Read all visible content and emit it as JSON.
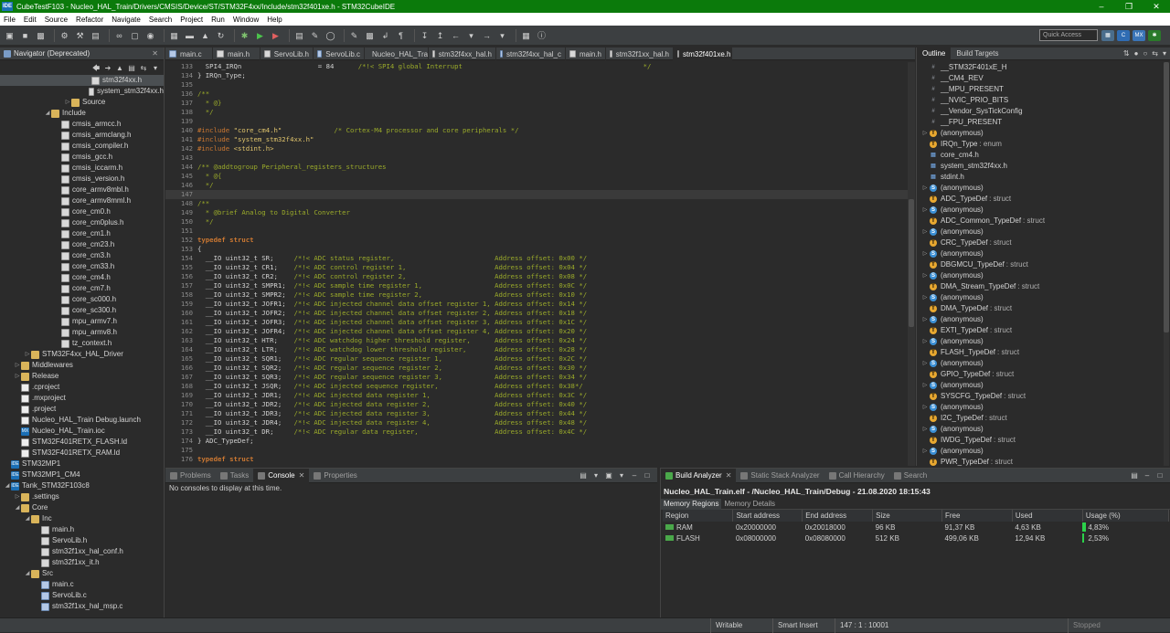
{
  "window": {
    "title": "CubeTestF103 - Nucleo_HAL_Train/Drivers/CMSIS/Device/ST/STM32F4xx/Include/stm32f401xe.h - STM32CubeIDE",
    "app_icon": "IDE"
  },
  "menu": [
    "File",
    "Edit",
    "Source",
    "Refactor",
    "Navigate",
    "Search",
    "Project",
    "Run",
    "Window",
    "Help"
  ],
  "quick_access": {
    "placeholder": "Quick Access"
  },
  "navigator": {
    "title": "Navigator (Deprecated)",
    "items": [
      {
        "label": "stm32f4xx.h",
        "level": 8,
        "icon": "h",
        "selected": true
      },
      {
        "label": "system_stm32f4xx.h",
        "level": 8,
        "icon": "h"
      },
      {
        "label": "Source",
        "level": 6,
        "icon": "folder",
        "twisty": "closed"
      },
      {
        "label": "Include",
        "level": 4,
        "icon": "folder",
        "twisty": "open"
      },
      {
        "label": "cmsis_armcc.h",
        "level": 5,
        "icon": "h"
      },
      {
        "label": "cmsis_armclang.h",
        "level": 5,
        "icon": "h"
      },
      {
        "label": "cmsis_compiler.h",
        "level": 5,
        "icon": "h"
      },
      {
        "label": "cmsis_gcc.h",
        "level": 5,
        "icon": "h"
      },
      {
        "label": "cmsis_iccarm.h",
        "level": 5,
        "icon": "h"
      },
      {
        "label": "cmsis_version.h",
        "level": 5,
        "icon": "h"
      },
      {
        "label": "core_armv8mbl.h",
        "level": 5,
        "icon": "h"
      },
      {
        "label": "core_armv8mml.h",
        "level": 5,
        "icon": "h"
      },
      {
        "label": "core_cm0.h",
        "level": 5,
        "icon": "h"
      },
      {
        "label": "core_cm0plus.h",
        "level": 5,
        "icon": "h"
      },
      {
        "label": "core_cm1.h",
        "level": 5,
        "icon": "h"
      },
      {
        "label": "core_cm23.h",
        "level": 5,
        "icon": "h"
      },
      {
        "label": "core_cm3.h",
        "level": 5,
        "icon": "h"
      },
      {
        "label": "core_cm33.h",
        "level": 5,
        "icon": "h"
      },
      {
        "label": "core_cm4.h",
        "level": 5,
        "icon": "h"
      },
      {
        "label": "core_cm7.h",
        "level": 5,
        "icon": "h"
      },
      {
        "label": "core_sc000.h",
        "level": 5,
        "icon": "h"
      },
      {
        "label": "core_sc300.h",
        "level": 5,
        "icon": "h"
      },
      {
        "label": "mpu_armv7.h",
        "level": 5,
        "icon": "h"
      },
      {
        "label": "mpu_armv8.h",
        "level": 5,
        "icon": "h"
      },
      {
        "label": "tz_context.h",
        "level": 5,
        "icon": "h"
      },
      {
        "label": "STM32F4xx_HAL_Driver",
        "level": 2,
        "icon": "folder",
        "twisty": "closed"
      },
      {
        "label": "Middlewares",
        "level": 1,
        "icon": "folder",
        "twisty": "closed"
      },
      {
        "label": "Release",
        "level": 1,
        "icon": "folder",
        "twisty": "closed"
      },
      {
        "label": ".cproject",
        "level": 1,
        "icon": "file"
      },
      {
        "label": ".mxproject",
        "level": 1,
        "icon": "file"
      },
      {
        "label": ".project",
        "level": 1,
        "icon": "file"
      },
      {
        "label": "Nucleo_HAL_Train Debug.launch",
        "level": 1,
        "icon": "file"
      },
      {
        "label": "Nucleo_HAL_Train.ioc",
        "level": 1,
        "icon": "mx"
      },
      {
        "label": "STM32F401RETX_FLASH.ld",
        "level": 1,
        "icon": "file"
      },
      {
        "label": "STM32F401RETX_RAM.ld",
        "level": 1,
        "icon": "file"
      },
      {
        "label": "STM32MP1",
        "level": 0,
        "icon": "proj"
      },
      {
        "label": "STM32MP1_CM4",
        "level": 0,
        "icon": "proj"
      },
      {
        "label": "Tank_STM32F103c8",
        "level": 0,
        "icon": "proj",
        "twisty": "open"
      },
      {
        "label": ".settings",
        "level": 1,
        "icon": "folder",
        "twisty": "closed"
      },
      {
        "label": "Core",
        "level": 1,
        "icon": "folder",
        "twisty": "open"
      },
      {
        "label": "Inc",
        "level": 2,
        "icon": "folder",
        "twisty": "open"
      },
      {
        "label": "main.h",
        "level": 3,
        "icon": "h"
      },
      {
        "label": "ServoLib.h",
        "level": 3,
        "icon": "h"
      },
      {
        "label": "stm32f1xx_hal_conf.h",
        "level": 3,
        "icon": "h"
      },
      {
        "label": "stm32f1xx_it.h",
        "level": 3,
        "icon": "h"
      },
      {
        "label": "Src",
        "level": 2,
        "icon": "folder",
        "twisty": "open"
      },
      {
        "label": "main.c",
        "level": 3,
        "icon": "c"
      },
      {
        "label": "ServoLib.c",
        "level": 3,
        "icon": "c"
      },
      {
        "label": "stm32f1xx_hal_msp.c",
        "level": 3,
        "icon": "c"
      }
    ]
  },
  "editor": {
    "tabs": [
      {
        "label": "main.c",
        "icon": "c"
      },
      {
        "label": "main.h",
        "icon": "h"
      },
      {
        "label": "ServoLib.h",
        "icon": "h"
      },
      {
        "label": "ServoLib.c",
        "icon": "c"
      },
      {
        "label": "Nucleo_HAL_Trai",
        "icon": "mx"
      },
      {
        "label": "stm32f4xx_hal.h",
        "icon": "h"
      },
      {
        "label": "stm32f4xx_hal_c",
        "icon": "c"
      },
      {
        "label": "main.h",
        "icon": "h"
      },
      {
        "label": "stm32f1xx_hal.h",
        "icon": "h"
      },
      {
        "label": "stm32f401xe.h",
        "icon": "h",
        "active": true
      }
    ],
    "lines": [
      {
        "n": "133",
        "t": "  SPI4_IRQn                   = 84      /*!< SPI4 global Interrupt                                             */"
      },
      {
        "n": "134",
        "t": "} IRQn_Type;"
      },
      {
        "n": "135",
        "t": ""
      },
      {
        "n": "136",
        "t": "/**"
      },
      {
        "n": "137",
        "t": "  * @}"
      },
      {
        "n": "138",
        "t": "  */"
      },
      {
        "n": "139",
        "t": ""
      },
      {
        "n": "140",
        "t": "#include \"core_cm4.h\"             /* Cortex-M4 processor and core peripherals */"
      },
      {
        "n": "141",
        "t": "#include \"system_stm32f4xx.h\""
      },
      {
        "n": "142",
        "t": "#include <stdint.h>"
      },
      {
        "n": "143",
        "t": ""
      },
      {
        "n": "144",
        "t": "/** @addtogroup Peripheral_registers_structures"
      },
      {
        "n": "145",
        "t": "  * @{"
      },
      {
        "n": "146",
        "t": "  */"
      },
      {
        "n": "147",
        "t": "",
        "cur": true
      },
      {
        "n": "148",
        "t": "/**"
      },
      {
        "n": "149",
        "t": "  * @brief Analog to Digital Converter"
      },
      {
        "n": "150",
        "t": "  */"
      },
      {
        "n": "151",
        "t": ""
      },
      {
        "n": "152",
        "t": "typedef struct"
      },
      {
        "n": "153",
        "t": "{"
      },
      {
        "n": "154",
        "t": "  __IO uint32_t SR;     /*!< ADC status register,                         Address offset: 0x00 */"
      },
      {
        "n": "155",
        "t": "  __IO uint32_t CR1;    /*!< ADC control register 1,                      Address offset: 0x04 */"
      },
      {
        "n": "156",
        "t": "  __IO uint32_t CR2;    /*!< ADC control register 2,                      Address offset: 0x08 */"
      },
      {
        "n": "157",
        "t": "  __IO uint32_t SMPR1;  /*!< ADC sample time register 1,                  Address offset: 0x0C */"
      },
      {
        "n": "158",
        "t": "  __IO uint32_t SMPR2;  /*!< ADC sample time register 2,                  Address offset: 0x10 */"
      },
      {
        "n": "159",
        "t": "  __IO uint32_t JOFR1;  /*!< ADC injected channel data offset register 1, Address offset: 0x14 */"
      },
      {
        "n": "160",
        "t": "  __IO uint32_t JOFR2;  /*!< ADC injected channel data offset register 2, Address offset: 0x18 */"
      },
      {
        "n": "161",
        "t": "  __IO uint32_t JOFR3;  /*!< ADC injected channel data offset register 3, Address offset: 0x1C */"
      },
      {
        "n": "162",
        "t": "  __IO uint32_t JOFR4;  /*!< ADC injected channel data offset register 4, Address offset: 0x20 */"
      },
      {
        "n": "163",
        "t": "  __IO uint32_t HTR;    /*!< ADC watchdog higher threshold register,      Address offset: 0x24 */"
      },
      {
        "n": "164",
        "t": "  __IO uint32_t LTR;    /*!< ADC watchdog lower threshold register,       Address offset: 0x28 */"
      },
      {
        "n": "165",
        "t": "  __IO uint32_t SQR1;   /*!< ADC regular sequence register 1,             Address offset: 0x2C */"
      },
      {
        "n": "166",
        "t": "  __IO uint32_t SQR2;   /*!< ADC regular sequence register 2,             Address offset: 0x30 */"
      },
      {
        "n": "167",
        "t": "  __IO uint32_t SQR3;   /*!< ADC regular sequence register 3,             Address offset: 0x34 */"
      },
      {
        "n": "168",
        "t": "  __IO uint32_t JSQR;   /*!< ADC injected sequence register,              Address offset: 0x38*/"
      },
      {
        "n": "169",
        "t": "  __IO uint32_t JDR1;   /*!< ADC injected data register 1,                Address offset: 0x3C */"
      },
      {
        "n": "170",
        "t": "  __IO uint32_t JDR2;   /*!< ADC injected data register 2,                Address offset: 0x40 */"
      },
      {
        "n": "171",
        "t": "  __IO uint32_t JDR3;   /*!< ADC injected data register 3,                Address offset: 0x44 */"
      },
      {
        "n": "172",
        "t": "  __IO uint32_t JDR4;   /*!< ADC injected data register 4,                Address offset: 0x48 */"
      },
      {
        "n": "173",
        "t": "  __IO uint32_t DR;     /*!< ADC regular data register,                   Address offset: 0x4C */"
      },
      {
        "n": "174",
        "t": "} ADC_TypeDef;"
      },
      {
        "n": "175",
        "t": ""
      },
      {
        "n": "176",
        "t": "typedef struct"
      }
    ]
  },
  "outline": {
    "tabs": [
      "Outline",
      "Build Targets"
    ],
    "items": [
      {
        "kind": "def",
        "label": "__STM32F401xE_H"
      },
      {
        "kind": "def",
        "label": "__CM4_REV"
      },
      {
        "kind": "def",
        "label": "__MPU_PRESENT"
      },
      {
        "kind": "def",
        "label": "__NVIC_PRIO_BITS"
      },
      {
        "kind": "def",
        "label": "__Vendor_SysTickConfig"
      },
      {
        "kind": "def",
        "label": "__FPU_PRESENT"
      },
      {
        "kind": "enum",
        "label": "(anonymous)",
        "twisty": true
      },
      {
        "kind": "enum",
        "label": "IRQn_Type",
        "type": ": enum"
      },
      {
        "kind": "inc",
        "label": "core_cm4.h"
      },
      {
        "kind": "inc",
        "label": "system_stm32f4xx.h"
      },
      {
        "kind": "inc",
        "label": "stdint.h"
      },
      {
        "kind": "struct",
        "label": "(anonymous)",
        "twisty": true
      },
      {
        "kind": "enum",
        "label": "ADC_TypeDef",
        "type": ": struct"
      },
      {
        "kind": "struct",
        "label": "(anonymous)",
        "twisty": true
      },
      {
        "kind": "enum",
        "label": "ADC_Common_TypeDef",
        "type": ": struct"
      },
      {
        "kind": "struct",
        "label": "(anonymous)",
        "twisty": true
      },
      {
        "kind": "enum",
        "label": "CRC_TypeDef",
        "type": ": struct"
      },
      {
        "kind": "struct",
        "label": "(anonymous)",
        "twisty": true
      },
      {
        "kind": "enum",
        "label": "DBGMCU_TypeDef",
        "type": ": struct"
      },
      {
        "kind": "struct",
        "label": "(anonymous)",
        "twisty": true
      },
      {
        "kind": "enum",
        "label": "DMA_Stream_TypeDef",
        "type": ": struct"
      },
      {
        "kind": "struct",
        "label": "(anonymous)",
        "twisty": true
      },
      {
        "kind": "enum",
        "label": "DMA_TypeDef",
        "type": ": struct"
      },
      {
        "kind": "struct",
        "label": "(anonymous)",
        "twisty": true
      },
      {
        "kind": "enum",
        "label": "EXTI_TypeDef",
        "type": ": struct"
      },
      {
        "kind": "struct",
        "label": "(anonymous)",
        "twisty": true
      },
      {
        "kind": "enum",
        "label": "FLASH_TypeDef",
        "type": ": struct"
      },
      {
        "kind": "struct",
        "label": "(anonymous)",
        "twisty": true
      },
      {
        "kind": "enum",
        "label": "GPIO_TypeDef",
        "type": ": struct"
      },
      {
        "kind": "struct",
        "label": "(anonymous)",
        "twisty": true
      },
      {
        "kind": "enum",
        "label": "SYSCFG_TypeDef",
        "type": ": struct"
      },
      {
        "kind": "struct",
        "label": "(anonymous)",
        "twisty": true
      },
      {
        "kind": "enum",
        "label": "I2C_TypeDef",
        "type": ": struct"
      },
      {
        "kind": "struct",
        "label": "(anonymous)",
        "twisty": true
      },
      {
        "kind": "enum",
        "label": "IWDG_TypeDef",
        "type": ": struct"
      },
      {
        "kind": "struct",
        "label": "(anonymous)",
        "twisty": true
      },
      {
        "kind": "enum",
        "label": "PWR_TypeDef",
        "type": ": struct"
      }
    ]
  },
  "console": {
    "tabs": [
      "Problems",
      "Tasks",
      "Console",
      "Properties"
    ],
    "active": "Console",
    "message": "No consoles to display at this time."
  },
  "build_analyzer": {
    "tabs": [
      "Build Analyzer",
      "Static Stack Analyzer",
      "Call Hierarchy",
      "Search"
    ],
    "title": "Nucleo_HAL_Train.elf - /Nucleo_HAL_Train/Debug - 21.08.2020 18:15:43",
    "subtabs": [
      "Memory Regions",
      "Memory Details"
    ],
    "columns": [
      "Region",
      "Start address",
      "End address",
      "Size",
      "Free",
      "Used",
      "Usage (%)"
    ],
    "rows": [
      {
        "region": "RAM",
        "start": "0x20000000",
        "end": "0x20018000",
        "size": "96 KB",
        "free": "91,37 KB",
        "used": "4,63 KB",
        "usage": "4,83%"
      },
      {
        "region": "FLASH",
        "start": "0x08000000",
        "end": "0x08080000",
        "size": "512 KB",
        "free": "499,06 KB",
        "used": "12,94 KB",
        "usage": "2,53%"
      }
    ]
  },
  "status": {
    "mode": "Writable",
    "insert": "Smart Insert",
    "position": "147 : 1 : 10001",
    "state": "Stopped"
  },
  "colors": {
    "titlebar": "#0b7a0b",
    "usage_bar": "#2bd24a",
    "background": "#2b2b2b"
  }
}
